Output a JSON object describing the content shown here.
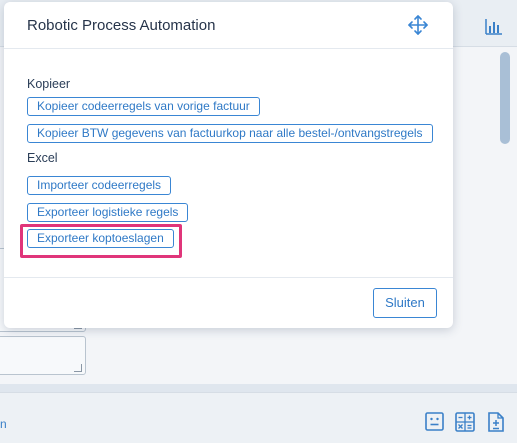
{
  "modal": {
    "title": "Robotic Process Automation",
    "sections": [
      {
        "title": "Kopieer",
        "buttons": [
          "Kopieer codeerregels van vorige factuur",
          "Kopieer BTW gegevens van factuurkop naar alle bestel-/ontvangstregels"
        ]
      },
      {
        "title": "Excel",
        "buttons": [
          "Importeer codeerregels",
          "Exporteer logistieke regels",
          "Exporteer koptoeslagen"
        ]
      }
    ],
    "close_label": "Sluiten"
  },
  "background": {
    "footer_text": "n",
    "icons": [
      "chart-icon",
      "face-icon",
      "calculator-icon",
      "document-icon"
    ]
  },
  "colors": {
    "accent": "#2f79c6",
    "highlight": "#e0357a"
  }
}
